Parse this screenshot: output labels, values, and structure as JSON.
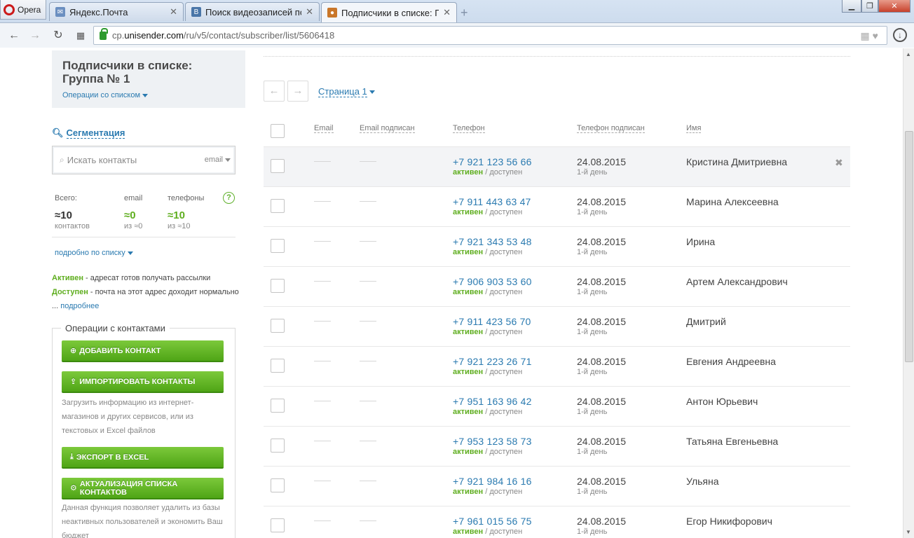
{
  "browser": {
    "app_name": "Opera",
    "tabs": [
      {
        "label": "Яндекс.Почта",
        "icon": "mail-icon"
      },
      {
        "label": "Поиск видеозаписей по с",
        "icon": "vk-icon"
      },
      {
        "label": "Подписчики в списке: Гру",
        "icon": "unisender-icon"
      }
    ],
    "url_prefix": "cp.",
    "url_host": "unisender.com",
    "url_path": "/ru/v5/contact/subscriber/list/5606418"
  },
  "sidebar": {
    "title": "Подписчики в списке: Группа № 1",
    "list_ops": "Операции со списком",
    "segmentation": "Сегментация",
    "search_placeholder": "Искать контакты",
    "search_type": "email",
    "stats": {
      "total_label": "Всего:",
      "email_label": "email",
      "phones_label": "телефоны",
      "total_value": "≈10",
      "total_sub": "контактов",
      "email_value": "≈0",
      "email_sub": "из ≈0",
      "phones_value": "≈10",
      "phones_sub": "из ≈10",
      "help": "?",
      "detail_link": "подробно по списку"
    },
    "legend": {
      "active_term": "Активен",
      "active_desc": " - адресат готов получать рассылки",
      "avail_term": "Доступен",
      "avail_desc": " - почта на этот адрес доходит нормально",
      "ellipsis": "... ",
      "more": "подробнее"
    },
    "ops": {
      "title": "Операции с контактами",
      "add_contact": "ДОБАВИТЬ КОНТАКТ",
      "import_contacts": "ИМПОРТИРОВАТЬ КОНТАКТЫ",
      "import_note": "Загрузить информацию из интернет-магазинов и других сервисов, или из текстовых и Excel файлов",
      "export_excel": "ЭКСПОРТ В EXCEL",
      "actualize": "АКТУАЛИЗАЦИЯ СПИСКА КОНТАКТОВ",
      "actualize_note": "Данная функция позволяет удалить из базы неактивных пользователей и экономить Ваш бюджет"
    }
  },
  "main": {
    "page_label": "Страница 1",
    "columns": [
      "Email",
      "Email подписан",
      "Телефон",
      "Телефон подписан",
      "Имя"
    ],
    "rows": [
      {
        "phone": "+7 921 123 56 66",
        "status": "активен",
        "status2": " / доступен",
        "date": "24.08.2015",
        "day": "1-й день",
        "name": "Кристина Дмитриевна"
      },
      {
        "phone": "+7 911 443 63 47",
        "status": "активен",
        "status2": " / доступен",
        "date": "24.08.2015",
        "day": "1-й день",
        "name": "Марина Алексеевна"
      },
      {
        "phone": "+7 921 343 53 48",
        "status": "активен",
        "status2": " / доступен",
        "date": "24.08.2015",
        "day": "1-й день",
        "name": "Ирина"
      },
      {
        "phone": "+7 906 903 53 60",
        "status": "активен",
        "status2": " / доступен",
        "date": "24.08.2015",
        "day": "1-й день",
        "name": "Артем Александрович"
      },
      {
        "phone": "+7 911 423 56 70",
        "status": "активен",
        "status2": " / доступен",
        "date": "24.08.2015",
        "day": "1-й день",
        "name": "Дмитрий"
      },
      {
        "phone": "+7 921 223 26 71",
        "status": "активен",
        "status2": " / доступен",
        "date": "24.08.2015",
        "day": "1-й день",
        "name": "Евгения Андреевна"
      },
      {
        "phone": "+7 951 163 96 42",
        "status": "активен",
        "status2": " / доступен",
        "date": "24.08.2015",
        "day": "1-й день",
        "name": "Антон Юрьевич"
      },
      {
        "phone": "+7 953 123 58 73",
        "status": "активен",
        "status2": " / доступен",
        "date": "24.08.2015",
        "day": "1-й день",
        "name": "Татьяна Евгеньевна"
      },
      {
        "phone": "+7 921 984 16 16",
        "status": "активен",
        "status2": " / доступен",
        "date": "24.08.2015",
        "day": "1-й день",
        "name": "Ульяна"
      },
      {
        "phone": "+7 961 015 56 75",
        "status": "активен",
        "status2": " / доступен",
        "date": "24.08.2015",
        "day": "1-й день",
        "name": "Егор Никифорович"
      }
    ]
  }
}
